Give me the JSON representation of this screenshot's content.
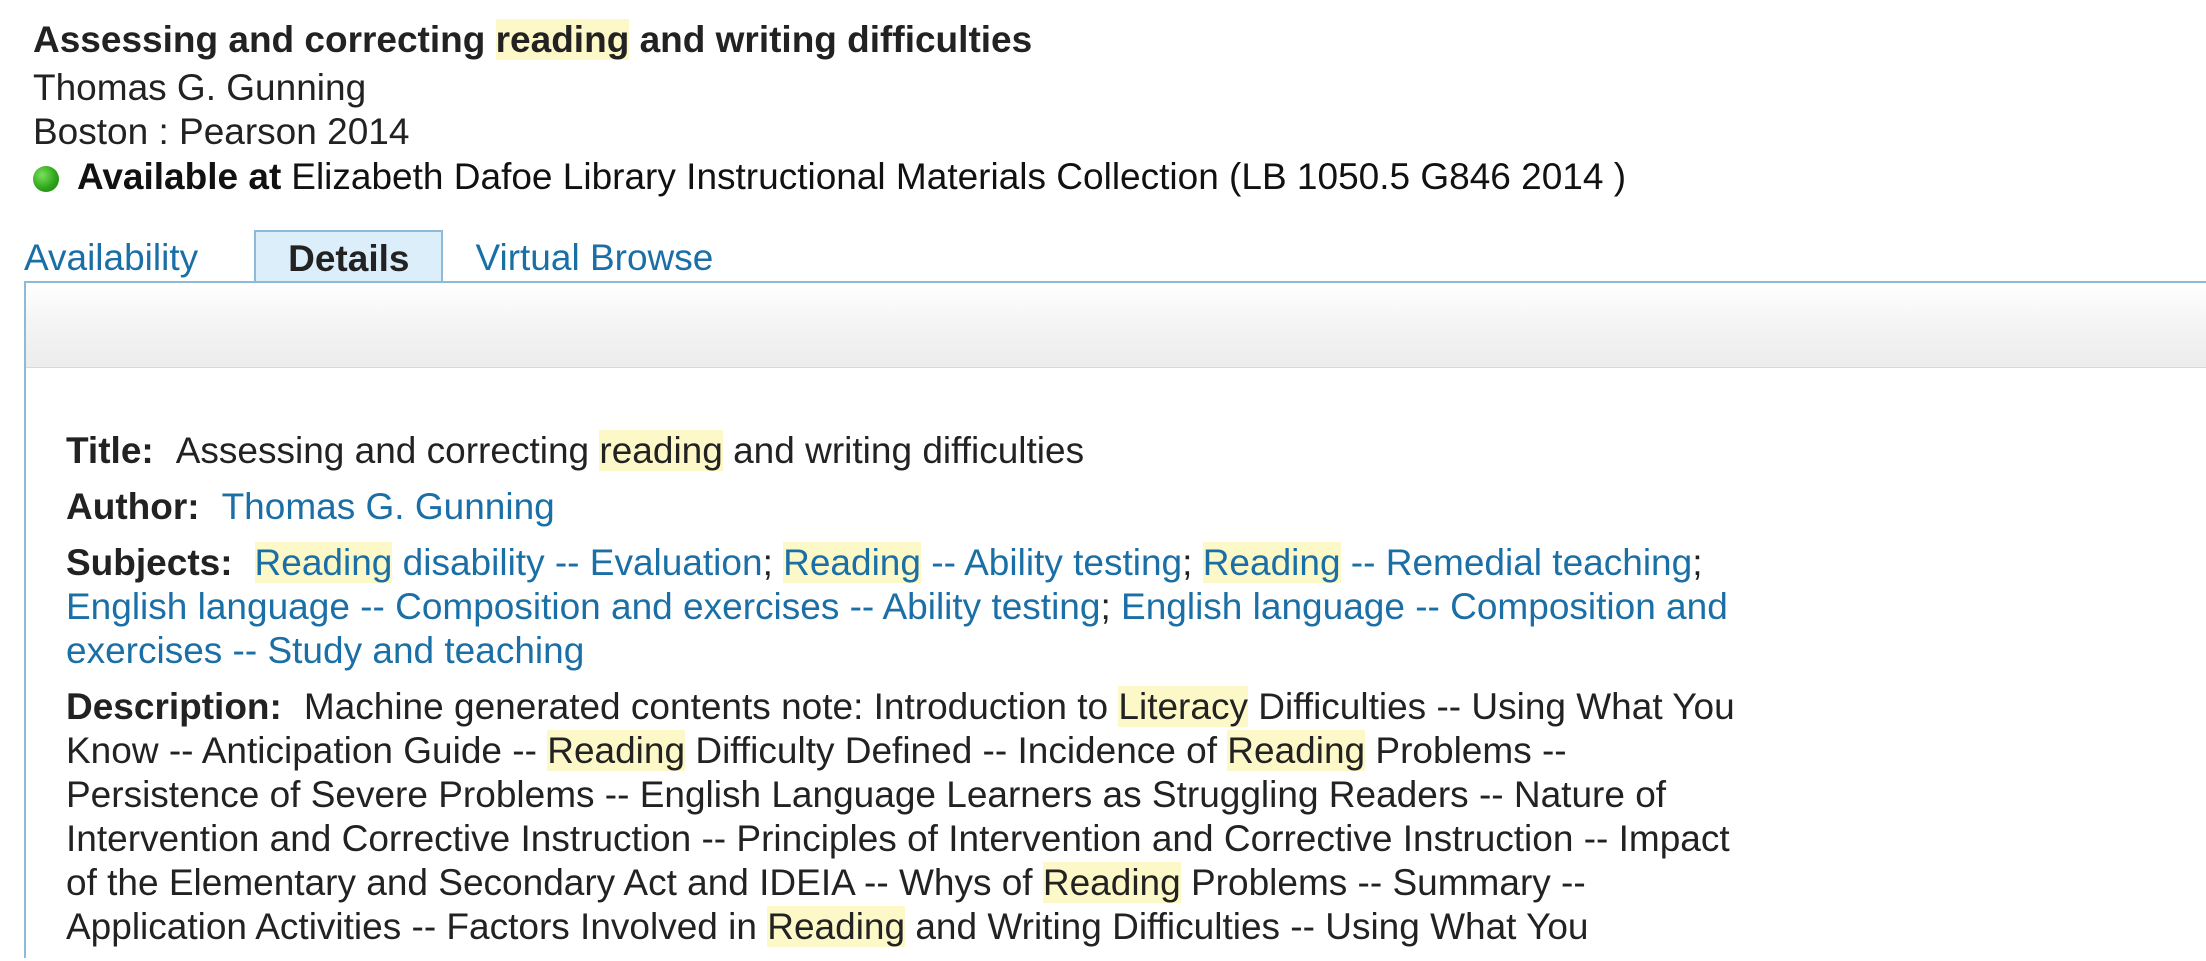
{
  "record": {
    "title_pre": "Assessing and correcting ",
    "title_hl": "reading",
    "title_post": " and writing difficulties",
    "author": "Thomas G. Gunning",
    "publication": "Boston : Pearson 2014",
    "availability_label": "Available at",
    "availability_location": "Elizabeth Dafoe Library Instructional Materials Collection (LB 1050.5 G846 2014 )",
    "status_color": "#2fa61c"
  },
  "tabs": {
    "availability": "Availability",
    "details": "Details",
    "virtual_browse": "Virtual Browse"
  },
  "details": {
    "title_label": "Title:",
    "title_pre": "Assessing and correcting ",
    "title_hl": "reading",
    "title_post": " and writing difficulties",
    "author_label": "Author:",
    "author": "Thomas G. Gunning",
    "subjects_label": "Subjects:",
    "subjects": [
      {
        "hl": "Reading",
        "rest": " disability -- Evaluation"
      },
      {
        "hl": "Reading",
        "rest": " -- Ability testing"
      },
      {
        "hl": "Reading",
        "rest": " -- Remedial teaching"
      },
      {
        "hl": "",
        "rest": "English language -- Composition and exercises -- Ability testing"
      },
      {
        "hl": "",
        "rest": "English language -- Composition and exercises -- Study and teaching"
      }
    ],
    "subject_separator": "; ",
    "description_label": "Description:",
    "description_parts": [
      {
        "t": "Machine generated contents note: Introduction to ",
        "h": false
      },
      {
        "t": "Literacy",
        "h": true
      },
      {
        "t": " Difficulties -- Using What You Know -- Anticipation Guide -- ",
        "h": false
      },
      {
        "t": "Reading",
        "h": true
      },
      {
        "t": " Difficulty Defined -- Incidence of ",
        "h": false
      },
      {
        "t": "Reading",
        "h": true
      },
      {
        "t": " Problems -- Persistence of Severe Problems -- English Language Learners as Struggling Readers -- Nature of Intervention and Corrective Instruction -- Principles of Intervention and Corrective Instruction -- Impact of the Elementary and Secondary Act and IDEIA -- Whys of ",
        "h": false
      },
      {
        "t": "Reading",
        "h": true
      },
      {
        "t": " Problems -- Summary -- Application Activities -- Factors Involved in ",
        "h": false
      },
      {
        "t": "Reading",
        "h": true
      },
      {
        "t": " and Writing Difficulties -- Using What You",
        "h": false
      }
    ]
  },
  "colors": {
    "link": "#1a6fa6",
    "highlight": "#fdf8c8",
    "tab_active_bg": "#dceefa",
    "border": "#8dbad8"
  }
}
